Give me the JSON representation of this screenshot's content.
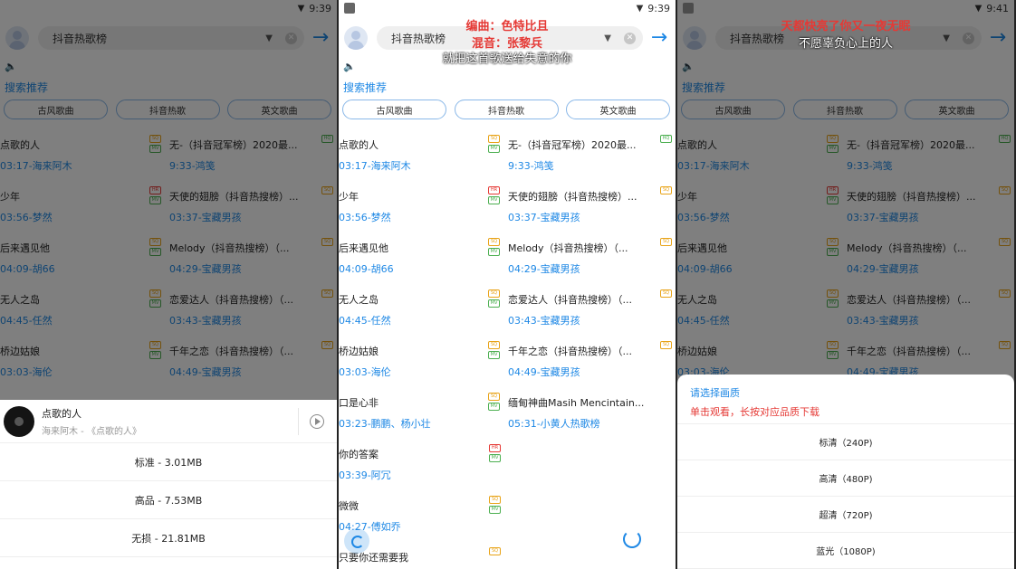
{
  "status": {
    "p1_time": "9:39",
    "p2_time": "9:39",
    "p3_time": "9:41"
  },
  "search": {
    "query": "抖音热歌榜"
  },
  "section_title": "搜索推荐",
  "chips": [
    "古风歌曲",
    "抖音热歌",
    "英文歌曲"
  ],
  "songs": [
    {
      "left_title": "点歌的人",
      "left_sub": "03:17-海来阿木",
      "right_title": "无-（抖音冠军榜）2020最...",
      "right_sub": "9:33-鸿笺",
      "right_badges": [
        "SQ",
        "MV"
      ],
      "right_tag": "HQ"
    },
    {
      "left_title": "少年",
      "left_sub": "03:56-梦然",
      "right_title": "天使的翅膀（抖音热搜榜）...",
      "right_sub": "03:37-宝藏男孩",
      "right_badges": [
        "HR",
        "MV"
      ],
      "right_tag": "SQ"
    },
    {
      "left_title": "后来遇见他",
      "left_sub": "04:09-胡66",
      "right_title": "Melody（抖音热搜榜）（...",
      "right_sub": "04:29-宝藏男孩",
      "right_badges": [
        "SQ",
        "MV"
      ],
      "right_tag": "SQ"
    },
    {
      "left_title": "无人之岛",
      "left_sub": "04:45-任然",
      "right_title": "恋爱达人（抖音热搜榜）（...",
      "right_sub": "03:43-宝藏男孩",
      "right_badges": [
        "SQ",
        "MV"
      ],
      "right_tag": "SQ"
    },
    {
      "left_title": "桥边姑娘",
      "left_sub": "03:03-海伦",
      "right_title": "千年之恋（抖音热搜榜）（...",
      "right_sub": "04:49-宝藏男孩",
      "right_badges": [
        "SQ",
        "MV"
      ],
      "right_tag": "SQ"
    },
    {
      "left_title": "口是心非",
      "left_sub": "03:23-鹏鹏、杨小壮",
      "right_title": "缅甸神曲Masih Mencintain...",
      "right_sub": "05:31-小黄人热歌榜",
      "right_badges": [
        "SQ",
        "MV"
      ],
      "right_tag": ""
    },
    {
      "left_title": "你的答案",
      "left_sub": "03:39-阿冗",
      "left_badges": [
        "HR",
        "MV"
      ]
    },
    {
      "left_title": "微微",
      "left_sub": "04:27-傅如乔",
      "left_badges": [
        "SQ",
        "MV"
      ]
    },
    {
      "left_title": "只要你还需要我",
      "left_sub": "",
      "left_badges": [
        "SQ"
      ]
    }
  ],
  "panel1_sheet": {
    "song_title": "点歌的人",
    "song_sub": "海来阿木 - 《点歌的人》",
    "options": [
      "标准 - 3.01MB",
      "高品 - 7.53MB",
      "无损 - 21.81MB"
    ]
  },
  "panel2_overlay": {
    "line1": "编曲：色特比且",
    "line2": "混音：张黎兵",
    "line3": "就把这首歌送给失意的你"
  },
  "panel3_overlay": {
    "line1": "天都快亮了你又一夜无眠",
    "line2": "不愿辜负心上的人"
  },
  "panel3_sheet": {
    "title": "请选择画质",
    "hint": "单击观看，长按对应品质下载",
    "options": [
      "标清（240P)",
      "高清（480P)",
      "超清（720P)",
      "蓝光（1080P)"
    ]
  },
  "colors": {
    "accent": "#1e88e5",
    "red": "#e53935",
    "badge_sq": "#e8a317",
    "badge_mv": "#4caf50"
  }
}
